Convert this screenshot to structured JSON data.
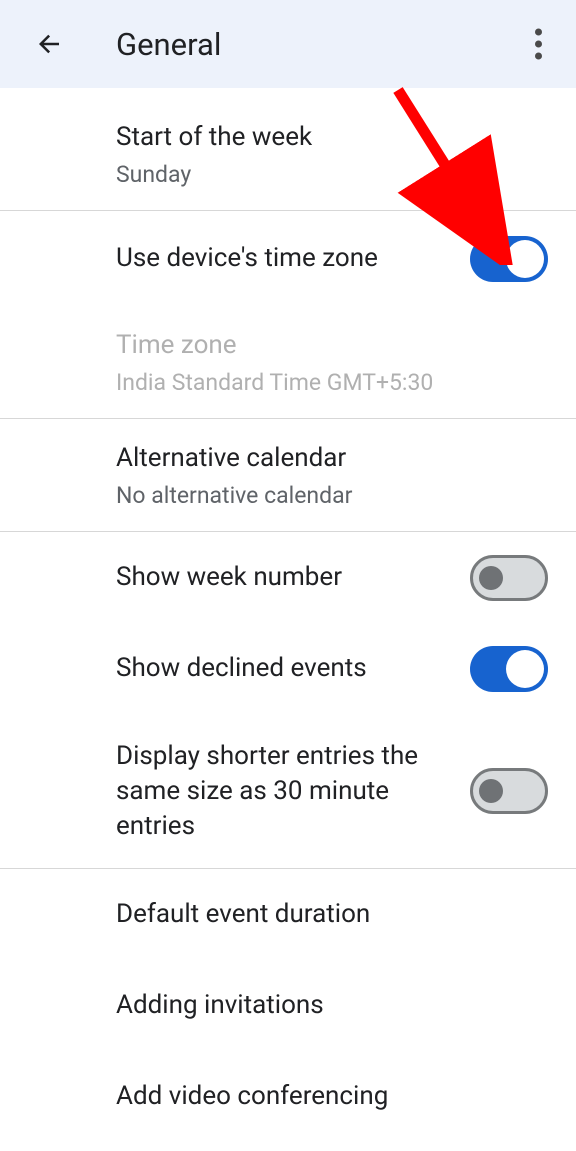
{
  "header": {
    "title": "General"
  },
  "items": {
    "start_week": {
      "title": "Start of the week",
      "value": "Sunday"
    },
    "use_device_tz": {
      "title": "Use device's time zone"
    },
    "time_zone": {
      "title": "Time zone",
      "value": "India Standard Time  GMT+5:30"
    },
    "alt_calendar": {
      "title": "Alternative calendar",
      "value": "No alternative calendar"
    },
    "show_week_number": {
      "title": "Show week number"
    },
    "show_declined": {
      "title": "Show declined events"
    },
    "shorter_entries": {
      "title": "Display shorter entries the same size as 30 minute entries"
    },
    "default_duration": {
      "title": "Default event duration"
    },
    "adding_invitations": {
      "title": "Adding invitations"
    },
    "add_video": {
      "title": "Add video conferencing"
    }
  },
  "colors": {
    "accent": "#1763cf",
    "arrow": "#ff0000"
  }
}
